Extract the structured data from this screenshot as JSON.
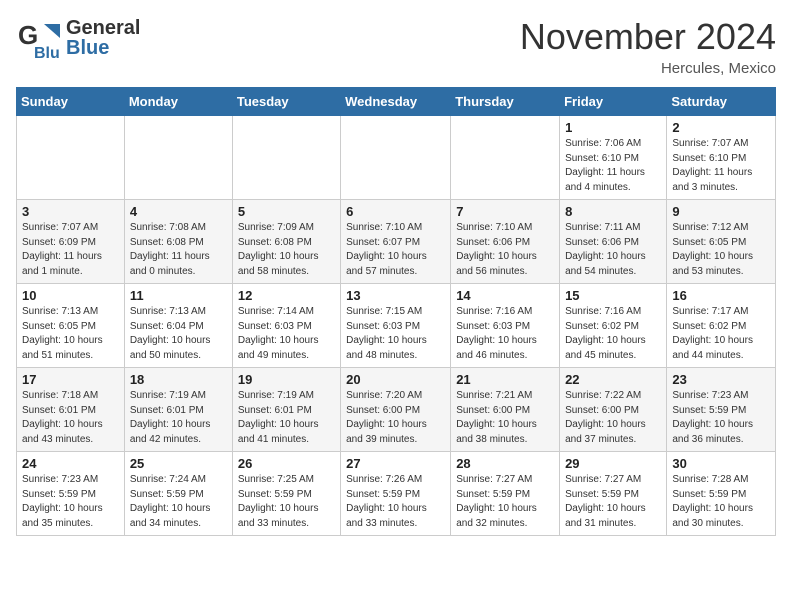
{
  "header": {
    "logo_line1": "General",
    "logo_line2": "Blue",
    "month_title": "November 2024",
    "location": "Hercules, Mexico"
  },
  "calendar": {
    "days_of_week": [
      "Sunday",
      "Monday",
      "Tuesday",
      "Wednesday",
      "Thursday",
      "Friday",
      "Saturday"
    ],
    "weeks": [
      [
        {
          "day": "",
          "info": ""
        },
        {
          "day": "",
          "info": ""
        },
        {
          "day": "",
          "info": ""
        },
        {
          "day": "",
          "info": ""
        },
        {
          "day": "",
          "info": ""
        },
        {
          "day": "1",
          "info": "Sunrise: 7:06 AM\nSunset: 6:10 PM\nDaylight: 11 hours\nand 4 minutes."
        },
        {
          "day": "2",
          "info": "Sunrise: 7:07 AM\nSunset: 6:10 PM\nDaylight: 11 hours\nand 3 minutes."
        }
      ],
      [
        {
          "day": "3",
          "info": "Sunrise: 7:07 AM\nSunset: 6:09 PM\nDaylight: 11 hours\nand 1 minute."
        },
        {
          "day": "4",
          "info": "Sunrise: 7:08 AM\nSunset: 6:08 PM\nDaylight: 11 hours\nand 0 minutes."
        },
        {
          "day": "5",
          "info": "Sunrise: 7:09 AM\nSunset: 6:08 PM\nDaylight: 10 hours\nand 58 minutes."
        },
        {
          "day": "6",
          "info": "Sunrise: 7:10 AM\nSunset: 6:07 PM\nDaylight: 10 hours\nand 57 minutes."
        },
        {
          "day": "7",
          "info": "Sunrise: 7:10 AM\nSunset: 6:06 PM\nDaylight: 10 hours\nand 56 minutes."
        },
        {
          "day": "8",
          "info": "Sunrise: 7:11 AM\nSunset: 6:06 PM\nDaylight: 10 hours\nand 54 minutes."
        },
        {
          "day": "9",
          "info": "Sunrise: 7:12 AM\nSunset: 6:05 PM\nDaylight: 10 hours\nand 53 minutes."
        }
      ],
      [
        {
          "day": "10",
          "info": "Sunrise: 7:13 AM\nSunset: 6:05 PM\nDaylight: 10 hours\nand 51 minutes."
        },
        {
          "day": "11",
          "info": "Sunrise: 7:13 AM\nSunset: 6:04 PM\nDaylight: 10 hours\nand 50 minutes."
        },
        {
          "day": "12",
          "info": "Sunrise: 7:14 AM\nSunset: 6:03 PM\nDaylight: 10 hours\nand 49 minutes."
        },
        {
          "day": "13",
          "info": "Sunrise: 7:15 AM\nSunset: 6:03 PM\nDaylight: 10 hours\nand 48 minutes."
        },
        {
          "day": "14",
          "info": "Sunrise: 7:16 AM\nSunset: 6:03 PM\nDaylight: 10 hours\nand 46 minutes."
        },
        {
          "day": "15",
          "info": "Sunrise: 7:16 AM\nSunset: 6:02 PM\nDaylight: 10 hours\nand 45 minutes."
        },
        {
          "day": "16",
          "info": "Sunrise: 7:17 AM\nSunset: 6:02 PM\nDaylight: 10 hours\nand 44 minutes."
        }
      ],
      [
        {
          "day": "17",
          "info": "Sunrise: 7:18 AM\nSunset: 6:01 PM\nDaylight: 10 hours\nand 43 minutes."
        },
        {
          "day": "18",
          "info": "Sunrise: 7:19 AM\nSunset: 6:01 PM\nDaylight: 10 hours\nand 42 minutes."
        },
        {
          "day": "19",
          "info": "Sunrise: 7:19 AM\nSunset: 6:01 PM\nDaylight: 10 hours\nand 41 minutes."
        },
        {
          "day": "20",
          "info": "Sunrise: 7:20 AM\nSunset: 6:00 PM\nDaylight: 10 hours\nand 39 minutes."
        },
        {
          "day": "21",
          "info": "Sunrise: 7:21 AM\nSunset: 6:00 PM\nDaylight: 10 hours\nand 38 minutes."
        },
        {
          "day": "22",
          "info": "Sunrise: 7:22 AM\nSunset: 6:00 PM\nDaylight: 10 hours\nand 37 minutes."
        },
        {
          "day": "23",
          "info": "Sunrise: 7:23 AM\nSunset: 5:59 PM\nDaylight: 10 hours\nand 36 minutes."
        }
      ],
      [
        {
          "day": "24",
          "info": "Sunrise: 7:23 AM\nSunset: 5:59 PM\nDaylight: 10 hours\nand 35 minutes."
        },
        {
          "day": "25",
          "info": "Sunrise: 7:24 AM\nSunset: 5:59 PM\nDaylight: 10 hours\nand 34 minutes."
        },
        {
          "day": "26",
          "info": "Sunrise: 7:25 AM\nSunset: 5:59 PM\nDaylight: 10 hours\nand 33 minutes."
        },
        {
          "day": "27",
          "info": "Sunrise: 7:26 AM\nSunset: 5:59 PM\nDaylight: 10 hours\nand 33 minutes."
        },
        {
          "day": "28",
          "info": "Sunrise: 7:27 AM\nSunset: 5:59 PM\nDaylight: 10 hours\nand 32 minutes."
        },
        {
          "day": "29",
          "info": "Sunrise: 7:27 AM\nSunset: 5:59 PM\nDaylight: 10 hours\nand 31 minutes."
        },
        {
          "day": "30",
          "info": "Sunrise: 7:28 AM\nSunset: 5:59 PM\nDaylight: 10 hours\nand 30 minutes."
        }
      ]
    ]
  }
}
